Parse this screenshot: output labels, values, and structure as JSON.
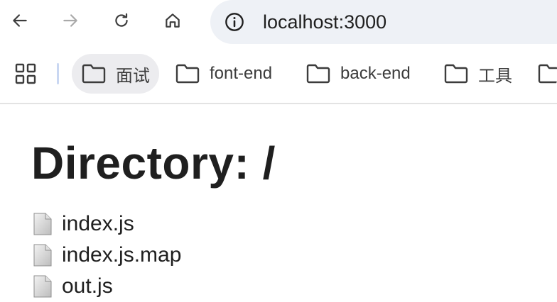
{
  "browser": {
    "address_bar": {
      "url": "localhost:3000"
    },
    "bookmarks": [
      {
        "label": "面试",
        "icon": "folder-icon",
        "active": true
      },
      {
        "label": "font-end",
        "icon": "folder-icon",
        "active": false
      },
      {
        "label": "back-end",
        "icon": "folder-icon",
        "active": false
      },
      {
        "label": "工具",
        "icon": "folder-icon",
        "active": false
      }
    ]
  },
  "page": {
    "title": "Directory: /",
    "files": [
      {
        "name": "index.js",
        "icon": "file-icon"
      },
      {
        "name": "index.js.map",
        "icon": "file-icon"
      },
      {
        "name": "out.js",
        "icon": "file-icon"
      }
    ]
  },
  "colors": {
    "omnibox_bg": "#eef1f6",
    "active_bookmark_bg": "#ececef",
    "separator": "#c9d7f2"
  }
}
